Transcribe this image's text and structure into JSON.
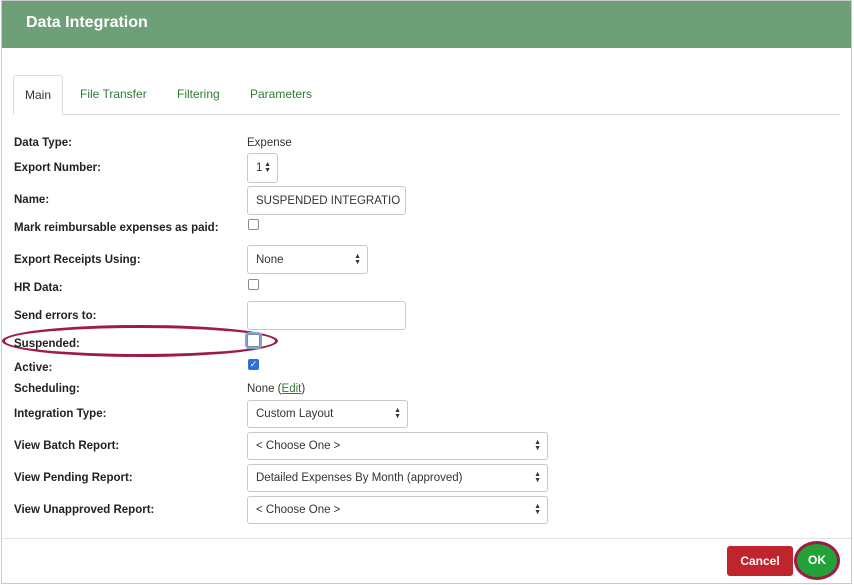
{
  "window": {
    "title": "Data Integration"
  },
  "tabs": [
    {
      "label": "Main"
    },
    {
      "label": "File Transfer"
    },
    {
      "label": "Filtering"
    },
    {
      "label": "Parameters"
    }
  ],
  "form": {
    "data_type": {
      "label": "Data Type:",
      "value": "Expense"
    },
    "export_number": {
      "label": "Export Number:",
      "value": "1"
    },
    "name": {
      "label": "Name:",
      "value": "SUSPENDED INTEGRATIO"
    },
    "mark_reimbursable": {
      "label": "Mark reimbursable expenses as paid:",
      "checked": false
    },
    "export_receipts": {
      "label": "Export Receipts Using:",
      "value": "None"
    },
    "hr_data": {
      "label": "HR Data:",
      "checked": false
    },
    "send_errors": {
      "label": "Send errors to:",
      "value": ""
    },
    "suspended": {
      "label": "Suspended:",
      "checked": false
    },
    "active": {
      "label": "Active:",
      "checked": true
    },
    "scheduling": {
      "label": "Scheduling:",
      "value_prefix": "None (",
      "edit_link": "Edit",
      "value_suffix": ")"
    },
    "integration_type": {
      "label": "Integration Type:",
      "value": "Custom Layout"
    },
    "view_batch_report": {
      "label": "View Batch Report:",
      "value": "< Choose One >"
    },
    "view_pending_report": {
      "label": "View Pending Report:",
      "value": "Detailed Expenses By Month (approved)"
    },
    "view_unapproved_report": {
      "label": "View Unapproved Report:",
      "value": "< Choose One >"
    }
  },
  "footer": {
    "cancel_label": "Cancel",
    "ok_label": "OK"
  },
  "colors": {
    "header": "#6f9f78",
    "tab_link": "#2e7b32",
    "cancel": "#c0252d",
    "ok": "#23a23a",
    "annotation": "#9e1b44",
    "checkbox": "#2d6fdb"
  }
}
